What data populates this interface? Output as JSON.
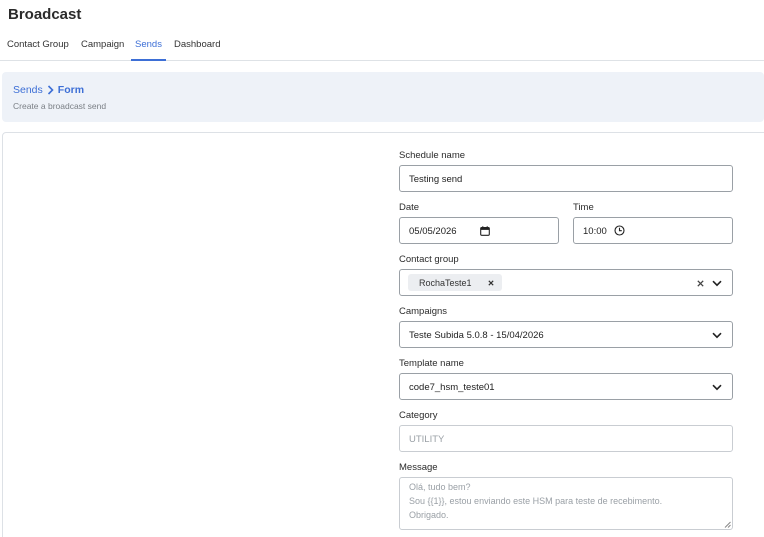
{
  "app": {
    "title": "Broadcast"
  },
  "nav": {
    "tabs": [
      {
        "label": "Contact Group"
      },
      {
        "label": "Campaign"
      },
      {
        "label": "Sends",
        "active": true
      },
      {
        "label": "Dashboard"
      }
    ]
  },
  "breadcrumb": {
    "parent": "Sends",
    "current": "Form",
    "subtitle": "Create a broadcast send"
  },
  "form": {
    "schedule_name": {
      "label": "Schedule name",
      "value": "Testing send"
    },
    "date": {
      "label": "Date",
      "value": "05/05/2026"
    },
    "time": {
      "label": "Time",
      "value": "10:00"
    },
    "contact_group": {
      "label": "Contact group",
      "selected": [
        "RochaTeste1"
      ]
    },
    "campaigns": {
      "label": "Campaigns",
      "value": "Teste Subida 5.0.8 - 15/04/2026"
    },
    "template_name": {
      "label": "Template name",
      "value": "code7_hsm_teste01"
    },
    "category": {
      "label": "Category",
      "value": "UTILITY"
    },
    "message": {
      "label": "Message",
      "lines": [
        "Olá, tudo bem?",
        "Sou {{1}}, estou enviando este HSM para teste de recebimento.",
        "Obrigado."
      ]
    }
  },
  "icons": {
    "date": "calendar-icon",
    "time": "clock-icon",
    "dropdown": "chevron-down-icon",
    "clear": "clear-icon",
    "chip_remove": "close-icon",
    "resize": "resize-handle-icon",
    "breadcrumb_separator": "chevron-right-icon"
  },
  "colors": {
    "accent": "#3d6fd6",
    "breadcrumb_bg": "#eef2f8"
  }
}
